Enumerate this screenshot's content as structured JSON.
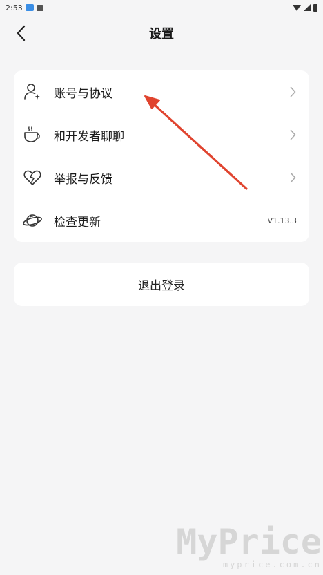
{
  "status_bar": {
    "time": "2:53"
  },
  "header": {
    "title": "设置"
  },
  "settings_items": [
    {
      "label": "账号与协议",
      "icon": "user-star-icon"
    },
    {
      "label": "和开发者聊聊",
      "icon": "coffee-cup-icon"
    },
    {
      "label": "举报与反馈",
      "icon": "broken-heart-icon"
    },
    {
      "label": "检查更新",
      "icon": "planet-icon",
      "value": "V1.13.3"
    }
  ],
  "logout": {
    "label": "退出登录"
  },
  "watermark": {
    "main": "MyPrice",
    "sub": "myprice.com.cn"
  },
  "colors": {
    "background": "#f5f5f6",
    "card": "#ffffff",
    "annotation": "#e0442f"
  }
}
